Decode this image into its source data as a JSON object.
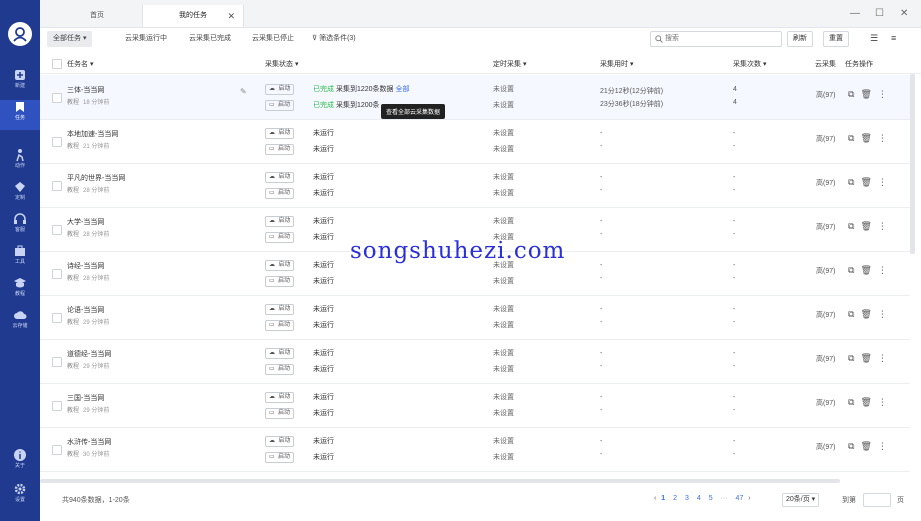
{
  "sidebar": {
    "items": [
      {
        "label": "新建",
        "icon": "plus-icon"
      },
      {
        "label": "任务",
        "icon": "task-icon"
      },
      {
        "label": "动作",
        "icon": "action-icon"
      },
      {
        "label": "定制",
        "icon": "custom-icon"
      },
      {
        "label": "客服",
        "icon": "headset-icon"
      },
      {
        "label": "工具",
        "icon": "toolbox-icon"
      },
      {
        "label": "教程",
        "icon": "tutorial-icon"
      },
      {
        "label": "云存储",
        "icon": "cloud-icon"
      },
      {
        "label": "关于",
        "icon": "info-icon"
      },
      {
        "label": "设置",
        "icon": "gear-icon"
      }
    ]
  },
  "tabs": [
    {
      "label": "首页"
    },
    {
      "label": "我的任务"
    }
  ],
  "toolbar": {
    "all_tasks": "全部任务",
    "cloud_running": "云采集运行中",
    "cloud_done": "云采集已完成",
    "cloud_stopped": "云采集已停止",
    "filter": "筛选条件(3)",
    "search_placeholder": "搜索",
    "refresh": "刷新",
    "reset": "重置"
  },
  "table": {
    "headers": {
      "name": "任务名",
      "status": "采集状态",
      "schedule": "定时采集",
      "duration": "采集用时",
      "count": "采集次数",
      "cloud": "云采集",
      "ops": "任务操作"
    },
    "ctl_start": "启动",
    "rows": [
      {
        "name": "三体-当当网",
        "tag": "教程",
        "time": "18 分钟前",
        "s1": "已完成",
        "s1b": "采集到1220条数据",
        "s1c": "全部",
        "s2": "已完成",
        "s2b": "采集到1200条",
        "sch1": "未设置",
        "sch2": "未设置",
        "d1": "21分12秒(12分钟前)",
        "d2": "23分36秒(18分钟前)",
        "c1": "4",
        "c2": "4",
        "cloud": "高(97)"
      },
      {
        "name": "本地加速-当当网",
        "tag": "教程",
        "time": "21 分钟前",
        "s1": "未运行",
        "s2": "未运行",
        "sch1": "未设置",
        "sch2": "未设置",
        "d1": "-",
        "d2": "-",
        "c1": "-",
        "c2": "-",
        "cloud": "高(97)"
      },
      {
        "name": "平凡的世界-当当网",
        "tag": "教程",
        "time": "28 分钟前",
        "s1": "未运行",
        "s2": "未运行",
        "sch1": "未设置",
        "sch2": "未设置",
        "d1": "-",
        "d2": "-",
        "c1": "-",
        "c2": "-",
        "cloud": "高(97)"
      },
      {
        "name": "大学-当当网",
        "tag": "教程",
        "time": "28 分钟前",
        "s1": "未运行",
        "s2": "未运行",
        "sch1": "未设置",
        "sch2": "未设置",
        "d1": "-",
        "d2": "-",
        "c1": "-",
        "c2": "-",
        "cloud": "高(97)"
      },
      {
        "name": "诗经-当当网",
        "tag": "教程",
        "time": "28 分钟前",
        "s1": "未运行",
        "s2": "未运行",
        "sch1": "未设置",
        "sch2": "未设置",
        "d1": "-",
        "d2": "-",
        "c1": "-",
        "c2": "-",
        "cloud": "高(97)"
      },
      {
        "name": "论语-当当网",
        "tag": "教程",
        "time": "29 分钟前",
        "s1": "未运行",
        "s2": "未运行",
        "sch1": "未设置",
        "sch2": "未设置",
        "d1": "-",
        "d2": "-",
        "c1": "-",
        "c2": "-",
        "cloud": "高(97)"
      },
      {
        "name": "道德经-当当网",
        "tag": "教程",
        "time": "29 分钟前",
        "s1": "未运行",
        "s2": "未运行",
        "sch1": "未设置",
        "sch2": "未设置",
        "d1": "-",
        "d2": "-",
        "c1": "-",
        "c2": "-",
        "cloud": "高(97)"
      },
      {
        "name": "三国-当当网",
        "tag": "教程",
        "time": "29 分钟前",
        "s1": "未运行",
        "s2": "未运行",
        "sch1": "未设置",
        "sch2": "未设置",
        "d1": "-",
        "d2": "-",
        "c1": "-",
        "c2": "-",
        "cloud": "高(97)"
      },
      {
        "name": "水浒传-当当网",
        "tag": "教程",
        "time": "30 分钟前",
        "s1": "未运行",
        "s2": "未运行",
        "sch1": "未设置",
        "sch2": "未设置",
        "d1": "-",
        "d2": "-",
        "c1": "-",
        "c2": "-",
        "cloud": "高(97)"
      }
    ]
  },
  "tooltip": "查看全部云采集数据",
  "footer": {
    "total": "共940条数据，1-20条",
    "pages": [
      "1",
      "2",
      "3",
      "4",
      "5",
      "···",
      "47"
    ],
    "page_size": "20条/页",
    "goto": "到第",
    "page_unit": "页"
  },
  "watermark": "songshuhezi.com"
}
